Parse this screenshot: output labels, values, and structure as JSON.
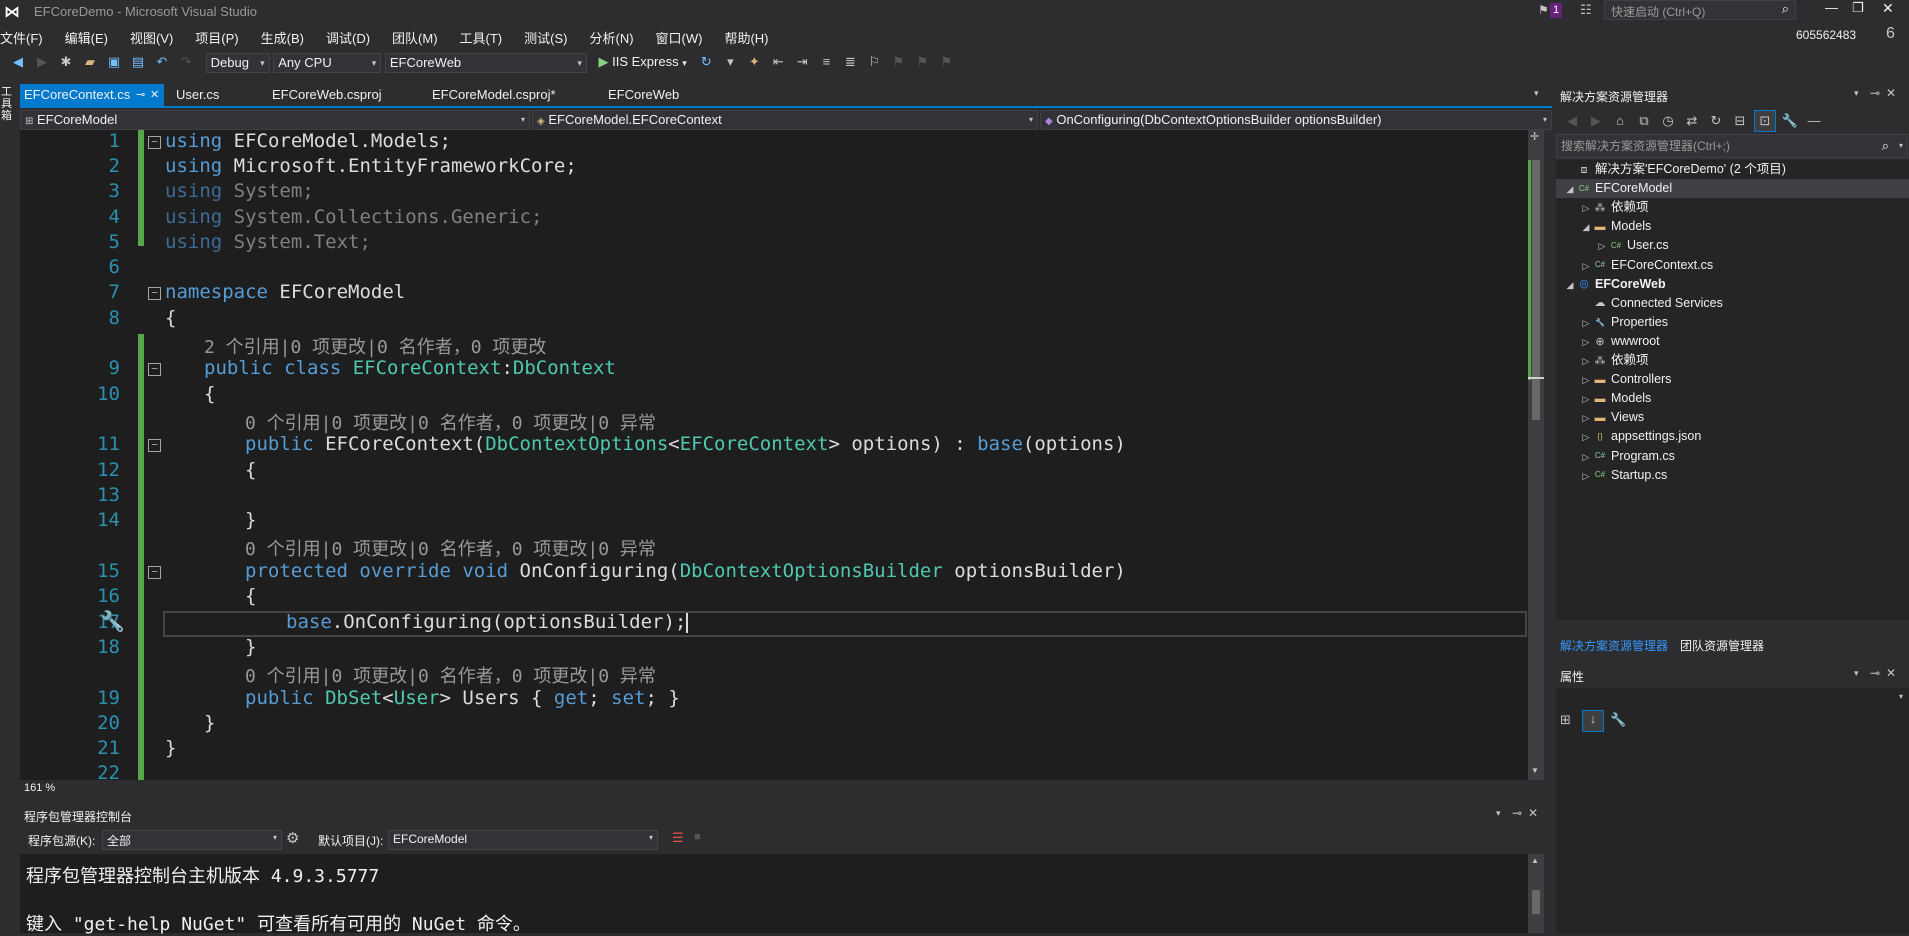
{
  "window": {
    "title": "EFCoreDemo - Microsoft Visual Studio",
    "notification_count": "1",
    "quick_launch_placeholder": "快速启动 (Ctrl+Q)",
    "user_id": "605562483",
    "live_share_badge": "6"
  },
  "menu": [
    "文件(F)",
    "编辑(E)",
    "视图(V)",
    "项目(P)",
    "生成(B)",
    "调试(D)",
    "团队(M)",
    "工具(T)",
    "测试(S)",
    "分析(N)",
    "窗口(W)",
    "帮助(H)"
  ],
  "toolbar": {
    "config": "Debug",
    "platform": "Any CPU",
    "startup_project": "EFCoreWeb",
    "run_label": "IIS Express"
  },
  "left_strip": {
    "label": "工具箱"
  },
  "doc_tabs": [
    {
      "label": "EFCoreContext.cs",
      "active": true
    },
    {
      "label": "User.cs"
    },
    {
      "label": "EFCoreWeb.csproj"
    },
    {
      "label": "EFCoreModel.csproj*"
    },
    {
      "label": "EFCoreWeb"
    }
  ],
  "navbar": {
    "project": "EFCoreModel",
    "type": "EFCoreModel.EFCoreContext",
    "member": "OnConfiguring(DbContextOptionsBuilder optionsBuilder)"
  },
  "editor": {
    "line_numbers": [
      "1",
      "2",
      "3",
      "4",
      "5",
      "6",
      "7",
      "8",
      "9",
      "10",
      "11",
      "12",
      "13",
      "14",
      "15",
      "16",
      "17",
      "18",
      "19",
      "20",
      "21",
      "22"
    ],
    "lens_class": "2 个引用|0 项更改|0 名作者，0 项更改",
    "lens_member": "0 个引用|0 项更改|0 名作者，0 项更改|0 异常",
    "zoom": "161 %",
    "lines": {
      "l1": [
        "using",
        " EFCoreModel.Models;"
      ],
      "l2": [
        "using",
        " Microsoft.EntityFrameworkCore;"
      ],
      "l3": [
        "using",
        " System;"
      ],
      "l4": [
        "using",
        " System.Collections.Generic;"
      ],
      "l5": [
        "using",
        " System.Text;"
      ],
      "l7": [
        "namespace",
        " EFCoreModel"
      ],
      "l8": "{",
      "l9": [
        "public class ",
        "EFCoreContext",
        ":",
        "DbContext"
      ],
      "l10": "{",
      "l11": [
        "public",
        " EFCoreContext(",
        "DbContextOptions",
        "<",
        "EFCoreContext",
        "> options) : ",
        "base",
        "(options)"
      ],
      "l12": "{",
      "l14": "}",
      "l15": [
        "protected override void",
        " OnConfiguring(",
        "DbContextOptionsBuilder",
        " optionsBuilder)"
      ],
      "l16": "{",
      "l17": [
        "base",
        ".OnConfiguring(optionsBuilder);"
      ],
      "l18": "}",
      "l19": [
        "public",
        " ",
        "DbSet",
        "<",
        "User",
        "> Users { ",
        "get",
        "; ",
        "set",
        "; }"
      ],
      "l20": "}",
      "l21": "}"
    }
  },
  "pmc": {
    "title": "程序包管理器控制台",
    "source_label": "程序包源(K):",
    "source_value": "全部",
    "default_project_label": "默认项目(J):",
    "default_project_value": "EFCoreModel",
    "line1": "程序包管理器控制台主机版本 4.9.3.5777",
    "line2": "键入 \"get-help NuGet\" 可查看所有可用的 NuGet 命令。"
  },
  "solution_explorer": {
    "title": "解决方案资源管理器",
    "search_placeholder": "搜索解决方案资源管理器(Ctrl+;)",
    "tree": [
      {
        "label": "解决方案'EFCoreDemo' (2 个项目)",
        "depth": 0,
        "icon": "solution-icon",
        "exp": ""
      },
      {
        "label": "EFCoreModel",
        "depth": 0,
        "icon": "csharp-project-icon",
        "exp": "◢",
        "selected": true
      },
      {
        "label": "依赖项",
        "depth": 1,
        "icon": "dependencies-icon",
        "exp": "▷"
      },
      {
        "label": "Models",
        "depth": 1,
        "icon": "folder-icon",
        "exp": "◢"
      },
      {
        "label": "User.cs",
        "depth": 2,
        "icon": "csharp-file-icon",
        "exp": "▷"
      },
      {
        "label": "EFCoreContext.cs",
        "depth": 1,
        "icon": "csharp-file-icon",
        "exp": "▷"
      },
      {
        "label": "EFCoreWeb",
        "depth": 0,
        "icon": "web-project-icon",
        "exp": "◢",
        "bold": true
      },
      {
        "label": "Connected Services",
        "depth": 1,
        "icon": "connected-services-icon",
        "exp": ""
      },
      {
        "label": "Properties",
        "depth": 1,
        "icon": "wrench-icon",
        "exp": "▷"
      },
      {
        "label": "wwwroot",
        "depth": 1,
        "icon": "globe-icon",
        "exp": "▷"
      },
      {
        "label": "依赖项",
        "depth": 1,
        "icon": "dependencies-icon",
        "exp": "▷"
      },
      {
        "label": "Controllers",
        "depth": 1,
        "icon": "folder-icon",
        "exp": "▷"
      },
      {
        "label": "Models",
        "depth": 1,
        "icon": "folder-icon",
        "exp": "▷"
      },
      {
        "label": "Views",
        "depth": 1,
        "icon": "folder-icon",
        "exp": "▷"
      },
      {
        "label": "appsettings.json",
        "depth": 1,
        "icon": "json-file-icon",
        "exp": "▷"
      },
      {
        "label": "Program.cs",
        "depth": 1,
        "icon": "csharp-file-icon",
        "exp": "▷"
      },
      {
        "label": "Startup.cs",
        "depth": 1,
        "icon": "csharp-file-icon",
        "exp": "▷"
      }
    ],
    "bottom_tabs": [
      "解决方案资源管理器",
      "团队资源管理器"
    ]
  },
  "properties": {
    "title": "属性"
  },
  "colors": {
    "accent": "#007acc",
    "keyword": "#569cd6",
    "type": "#4ec9b0",
    "line_number": "#2b91af",
    "change_bar": "#57a64a"
  }
}
